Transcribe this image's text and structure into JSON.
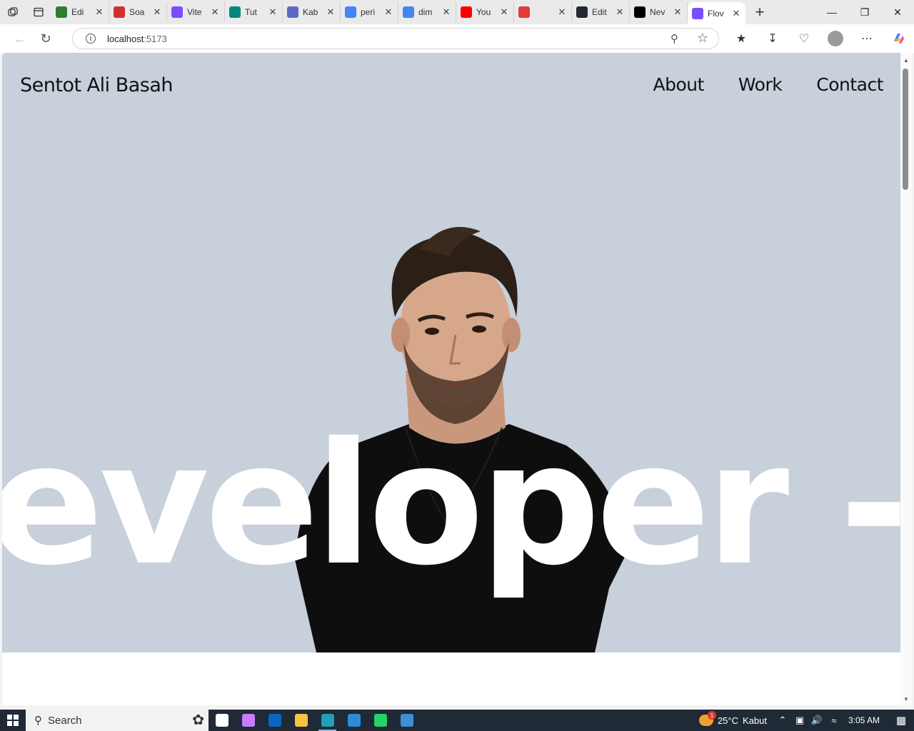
{
  "browser": {
    "tabs": [
      {
        "label": "Edi",
        "favicon_color": "#2e7d32"
      },
      {
        "label": "Soa",
        "favicon_color": "#d32f2f"
      },
      {
        "label": "Vite",
        "favicon_color": "#7c4dff"
      },
      {
        "label": "Tut",
        "favicon_color": "#00897b"
      },
      {
        "label": "Kab",
        "favicon_color": "#5c6bc0"
      },
      {
        "label": "peri",
        "favicon_color": "#4285f4"
      },
      {
        "label": "dim",
        "favicon_color": "#4285f4"
      },
      {
        "label": "You",
        "favicon_color": "#ff0000"
      },
      {
        "label": "",
        "favicon_color": "#e53935"
      },
      {
        "label": "Edit",
        "favicon_color": "#24292f"
      },
      {
        "label": "Nev",
        "favicon_color": "#000000"
      },
      {
        "label": "Flov",
        "favicon_color": "#7c4dff"
      }
    ],
    "active_tab_index": 11,
    "url_host": "localhost",
    "url_port": ":5173"
  },
  "site": {
    "logo": "Sentot Ali Basah",
    "nav": [
      "About",
      "Work",
      "Contact"
    ],
    "marquee_text": "Developer - Software Engineer - Developer - Software"
  },
  "taskbar": {
    "search_placeholder": "Search",
    "weather_temp": "25°C",
    "weather_text": "Kabut",
    "weather_badge": "1",
    "time": "3:05 AM",
    "apps": [
      {
        "name": "task-view",
        "color": "#ffffff"
      },
      {
        "name": "copilot",
        "color": "#c77dff"
      },
      {
        "name": "outlook",
        "color": "#0a66c2"
      },
      {
        "name": "file-explorer",
        "color": "#f4c542"
      },
      {
        "name": "edge",
        "color": "#1fa0b8"
      },
      {
        "name": "vscode",
        "color": "#2d8cd9"
      },
      {
        "name": "whatsapp",
        "color": "#25d366"
      },
      {
        "name": "paint",
        "color": "#3b8fd6"
      }
    ],
    "active_app": "edge"
  }
}
